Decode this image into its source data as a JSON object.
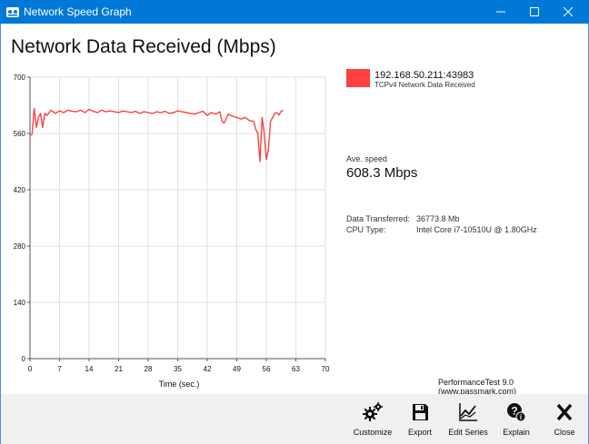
{
  "window": {
    "title": "Network Speed Graph"
  },
  "heading": "Network Data Received (Mbps)",
  "legend": {
    "name": "192.168.50.211:43983",
    "subtitle": "TCPv4 Network Data Received",
    "color": "#ff4040"
  },
  "stats": {
    "ave_label": "Ave. speed",
    "ave_value": "608.3 Mbps",
    "info": [
      {
        "key": "Data Transferred:",
        "value": "36773.8 Mb"
      },
      {
        "key": "CPU Type:",
        "value": "Intel Core i7-10510U @ 1.80GHz"
      }
    ]
  },
  "credit": "PerformanceTest 9.0 (www.passmark.com)",
  "toolbar": {
    "customize": "Customize",
    "export": "Export",
    "edit_series": "Edit Series",
    "explain": "Explain",
    "close": "Close"
  },
  "chart_data": {
    "type": "line",
    "xlabel": "Time (sec.)",
    "ylabel": "",
    "xlim": [
      0,
      70
    ],
    "ylim": [
      0,
      700
    ],
    "xticks": [
      0,
      7,
      14,
      21,
      28,
      35,
      42,
      49,
      56,
      63,
      70
    ],
    "yticks": [
      0,
      140,
      280,
      420,
      560,
      700
    ],
    "grid": true,
    "legend_position": "right",
    "series": [
      {
        "name": "192.168.50.211:43983",
        "color": "#ff4040",
        "x": [
          0,
          0.5,
          1,
          1.5,
          2,
          2.5,
          3,
          3.5,
          4,
          5,
          6,
          7,
          8,
          9,
          10,
          11,
          12,
          13,
          14,
          15,
          16,
          17,
          18,
          19,
          20,
          21,
          22,
          23,
          24,
          25,
          26,
          27,
          28,
          29,
          30,
          31,
          32,
          33,
          34,
          35,
          36,
          37,
          38,
          39,
          40,
          41,
          42,
          43,
          44,
          45,
          45.5,
          46,
          47,
          48,
          49,
          50,
          51,
          52,
          53,
          53.5,
          54,
          54.5,
          55,
          55.5,
          56,
          56.5,
          57,
          57.5,
          58,
          58.5,
          59,
          59.5,
          60
        ],
        "y": [
          555,
          558,
          622,
          575,
          600,
          610,
          575,
          610,
          605,
          618,
          610,
          616,
          612,
          618,
          615,
          614,
          618,
          612,
          620,
          615,
          612,
          618,
          614,
          616,
          614,
          612,
          616,
          614,
          612,
          615,
          610,
          614,
          612,
          610,
          614,
          612,
          615,
          610,
          612,
          616,
          614,
          612,
          610,
          608,
          612,
          615,
          605,
          612,
          608,
          614,
          590,
          586,
          608,
          603,
          600,
          596,
          600,
          592,
          590,
          570,
          560,
          490,
          600,
          560,
          495,
          520,
          590,
          600,
          610,
          612,
          606,
          615,
          618
        ]
      }
    ]
  }
}
